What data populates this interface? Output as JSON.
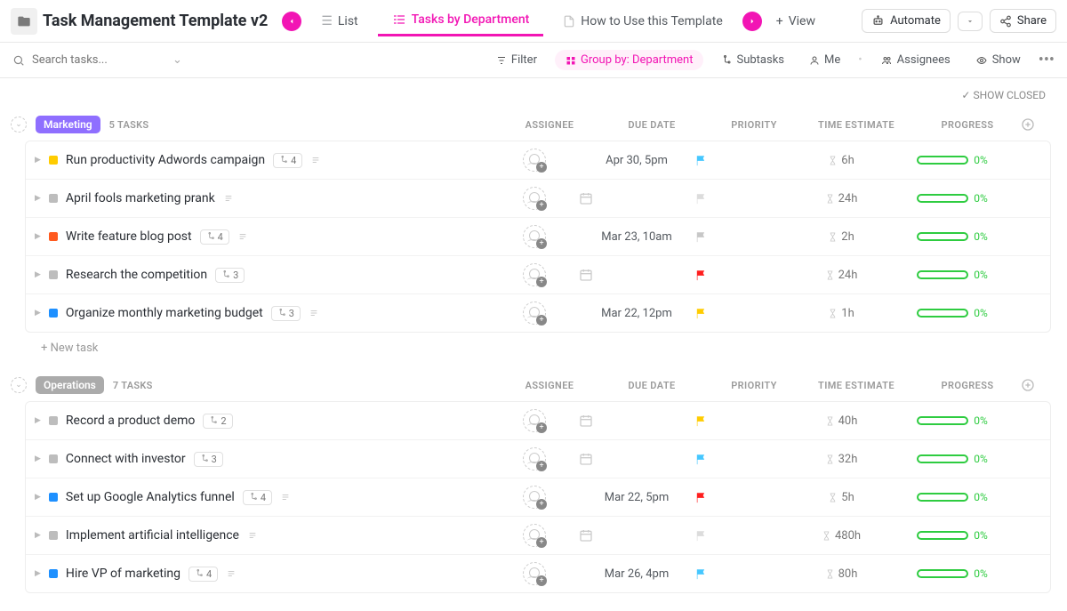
{
  "header": {
    "title": "Task Management Template v2",
    "tabs": [
      {
        "label": "List"
      },
      {
        "label": "Tasks by Department",
        "active": true
      },
      {
        "label": "How to Use this Template"
      }
    ],
    "add_view": "View",
    "automate": "Automate",
    "share": "Share"
  },
  "toolbar": {
    "search_placeholder": "Search tasks...",
    "filter": "Filter",
    "group_by": "Group by: Department",
    "subtasks": "Subtasks",
    "me": "Me",
    "assignees": "Assignees",
    "show": "Show"
  },
  "show_closed": "SHOW CLOSED",
  "columns": {
    "assignee": "ASSIGNEE",
    "due": "DUE DATE",
    "priority": "PRIORITY",
    "time": "TIME ESTIMATE",
    "progress": "PROGRESS"
  },
  "new_task": "New task",
  "groups": [
    {
      "name": "Marketing",
      "badgeClass": "marketing",
      "count": "5 TASKS",
      "tasks": [
        {
          "title": "Run productivity Adwords campaign",
          "status": "#ffcc00",
          "sub": "4",
          "desc": true,
          "due": "Apr 30, 5pm",
          "flag": "#45c7ff",
          "time": "6h",
          "pct": "0%"
        },
        {
          "title": "April fools marketing prank",
          "status": "#bdbdbd",
          "sub": "",
          "desc": true,
          "due": "",
          "flag": "#dcdcdc",
          "time": "24h",
          "pct": "0%"
        },
        {
          "title": "Write feature blog post",
          "status": "#ff5a1f",
          "sub": "4",
          "desc": true,
          "due": "Mar 23, 10am",
          "flag": "#c7c7c7",
          "time": "2h",
          "pct": "0%"
        },
        {
          "title": "Research the competition",
          "status": "#bdbdbd",
          "sub": "3",
          "desc": false,
          "due": "",
          "flag": "#ff1e1e",
          "time": "24h",
          "pct": "0%"
        },
        {
          "title": "Organize monthly marketing budget",
          "status": "#1e90ff",
          "sub": "3",
          "desc": true,
          "due": "Mar 22, 12pm",
          "flag": "#ffcc00",
          "time": "1h",
          "pct": "0%"
        }
      ]
    },
    {
      "name": "Operations",
      "badgeClass": "operations",
      "count": "7 TASKS",
      "tasks": [
        {
          "title": "Record a product demo",
          "status": "#bdbdbd",
          "sub": "2",
          "desc": false,
          "due": "",
          "flag": "#ffcc00",
          "time": "40h",
          "pct": "0%"
        },
        {
          "title": "Connect with investor",
          "status": "#bdbdbd",
          "sub": "3",
          "desc": false,
          "due": "",
          "flag": "#45c7ff",
          "time": "32h",
          "pct": "0%"
        },
        {
          "title": "Set up Google Analytics funnel",
          "status": "#1e90ff",
          "sub": "4",
          "desc": true,
          "due": "Mar 22, 5pm",
          "flag": "#ff1e1e",
          "time": "5h",
          "pct": "0%"
        },
        {
          "title": "Implement artificial intelligence",
          "status": "#bdbdbd",
          "sub": "",
          "desc": true,
          "due": "",
          "flag": "#dcdcdc",
          "time": "480h",
          "pct": "0%"
        },
        {
          "title": "Hire VP of marketing",
          "status": "#1e90ff",
          "sub": "4",
          "desc": true,
          "due": "Mar 26, 4pm",
          "flag": "#45c7ff",
          "time": "80h",
          "pct": "0%"
        }
      ]
    }
  ]
}
